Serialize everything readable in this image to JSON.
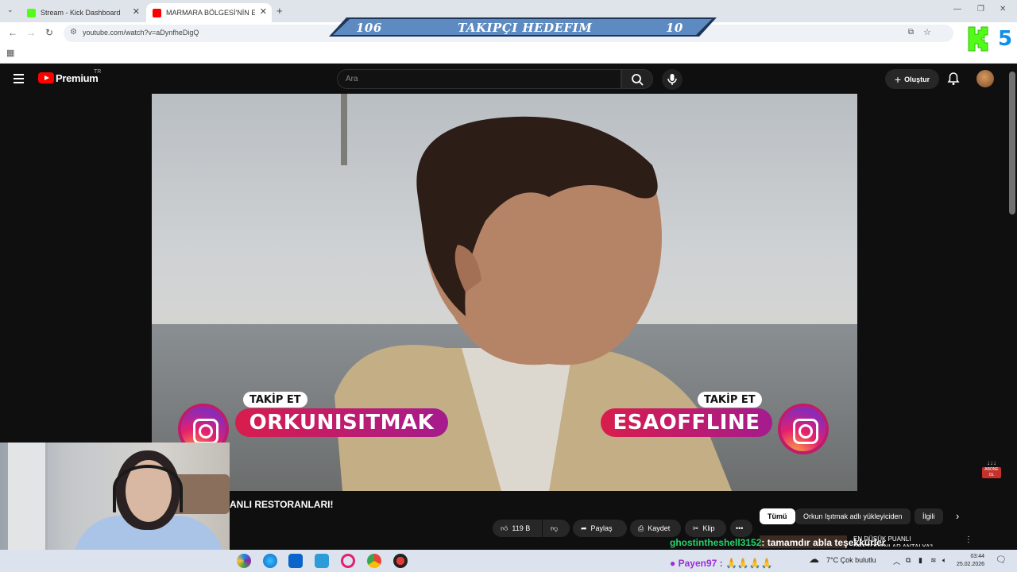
{
  "browser": {
    "tabs": [
      {
        "title": "Stream - Kick Dashboard",
        "active": false
      },
      {
        "title": "MARMARA BÖLGESİ'NİN EN D",
        "active": true
      }
    ],
    "url": "youtube.com/watch?v=aDynfheDigQ"
  },
  "overlay": {
    "goal_left": "106",
    "goal_title": "TAKIPÇI HEDEFIM",
    "goal_right": "10",
    "k_number": "5",
    "left_follow_tag": "TAKİP ET",
    "left_follow_name": "ORKUNISITMAK",
    "right_follow_tag": "TAKİP ET",
    "right_follow_name": "ESAOFFLINE"
  },
  "youtube": {
    "brand": "Premium",
    "region": "TR",
    "search_placeholder": "Ara",
    "create_label": "Oluştur",
    "video_title": "ANLI RESTORANLARI!",
    "actions": {
      "likes": "119 B",
      "share": "Paylaş",
      "save": "Kaydet",
      "clip": "Klip"
    },
    "chips": [
      "Tümü",
      "Orkun Işıtmak adlı yükleyiciden",
      "İlgili"
    ],
    "rec_title": "EN DÜŞÜK PUANLI RESTORANLAR ANTALYA'L"
  },
  "chat": {
    "user": "ghostintheshell3152",
    "message": ": tamamdır abla teşekkürler"
  },
  "donation": {
    "name": "Payen97 :",
    "emoji": "🙏🙏🙏🙏"
  },
  "taskbar": {
    "weather": "7°C  Çok bulutlu",
    "time": "03:44",
    "date": "25.02.2026"
  },
  "colors": {
    "chat_user": "#22d46a",
    "pill_start": "#d81d4c",
    "pill_end": "#a51b8e",
    "goal_bar": "#5d8ac1"
  }
}
